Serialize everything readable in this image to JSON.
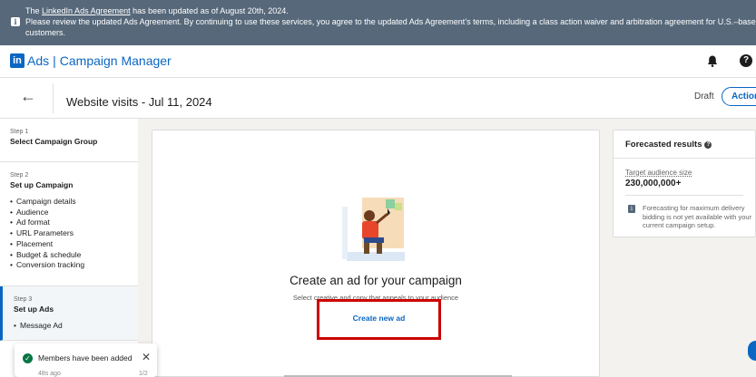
{
  "banner": {
    "line1_prefix": "The",
    "link_text": "LinkedIn Ads Agreement",
    "line1_suffix": "has been updated as of August 20th, 2024.",
    "line2": "Please review the updated Ads Agreement. By continuing to use these services, you agree to the updated Ads Agreement’s terms, including a class action waiver and arbitration agreement for U.S.–based",
    "line3": "customers."
  },
  "appbar": {
    "logo_text": "in",
    "product": "Ads",
    "separator": "|",
    "app_name": "Campaign Manager",
    "help_glyph": "?"
  },
  "titlebar": {
    "back_glyph": "←",
    "title": "Website visits - Jul 11, 2024",
    "status": "Draft",
    "actions_label": "Actions"
  },
  "sidebar": {
    "steps": [
      {
        "num": "Step 1",
        "title": "Select Campaign Group",
        "items": []
      },
      {
        "num": "Step 2",
        "title": "Set up Campaign",
        "items": [
          "Campaign details",
          "Audience",
          "Ad format",
          "URL Parameters",
          "Placement",
          "Budget & schedule",
          "Conversion tracking"
        ]
      },
      {
        "num": "Step 3",
        "title": "Set up Ads",
        "items": [
          "Message Ad"
        ]
      }
    ]
  },
  "toast": {
    "message": "Members have been added",
    "time": "48s ago",
    "count": "1/2",
    "check_glyph": "✓",
    "close_glyph": "✕"
  },
  "main": {
    "heading": "Create an ad for your campaign",
    "subheading": "Select creative and copy that appeals to your audience",
    "create_button": "Create new ad"
  },
  "forecast": {
    "title": "Forecasted results",
    "help_glyph": "?",
    "audience_label": "Target audience size",
    "audience_value": "230,000,000+",
    "info_glyph": "i",
    "note": "Forecasting for maximum delivery bidding is not yet available with your current campaign setup."
  },
  "colors": {
    "brand": "#0a66c2",
    "banner_bg": "#56687a",
    "highlight_border": "#cc0000",
    "success": "#057642"
  }
}
